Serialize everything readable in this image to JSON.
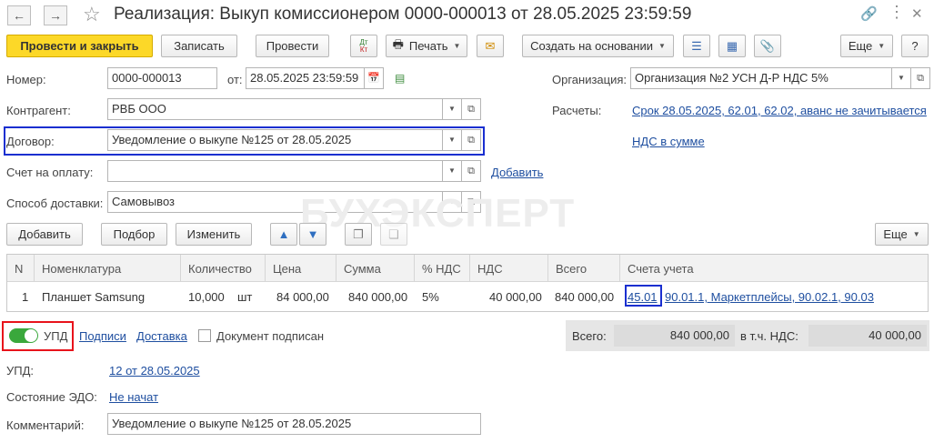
{
  "window": {
    "title": "Реализация: Выкуп комиссионером 0000-000013 от 28.05.2025 23:59:59"
  },
  "toolbar": {
    "post_close": "Провести и закрыть",
    "save": "Записать",
    "post": "Провести",
    "dt_kt_top": "Дт",
    "dt_kt_bottom": "Кт",
    "print": "Печать",
    "create_based": "Создать на основании",
    "more": "Еще",
    "help": "?"
  },
  "form": {
    "number_label": "Номер:",
    "number_value": "0000-000013",
    "from_label": "от:",
    "date_value": "28.05.2025 23:59:59",
    "org_label": "Организация:",
    "org_value": "Организация №2 УСН Д-Р НДС 5%",
    "counterparty_label": "Контрагент:",
    "counterparty_value": "РВБ ООО",
    "settlements_label": "Расчеты:",
    "settlements_link": "Срок 28.05.2025, 62.01, 62.02, аванс не зачитывается",
    "contract_label": "Договор:",
    "contract_value": "Уведомление о выкупе №125 от 28.05.2025",
    "vat_link": "НДС в сумме",
    "invoice_label": "Счет на оплату:",
    "invoice_value": "",
    "invoice_add_link": "Добавить",
    "delivery_label": "Способ доставки:",
    "delivery_value": "Самовывоз"
  },
  "watermark": "БУХЭКСПЕРТ",
  "table_toolbar": {
    "add": "Добавить",
    "pick": "Подбор",
    "edit": "Изменить",
    "more": "Еще"
  },
  "table": {
    "headers": [
      "N",
      "Номенклатура",
      "Количество",
      "Цена",
      "Сумма",
      "% НДС",
      "НДС",
      "Всего",
      "Счета учета"
    ],
    "rows": [
      {
        "n": "1",
        "item": "Планшет Samsung",
        "qty": "10,000",
        "unit": "шт",
        "price": "84 000,00",
        "sum": "840 000,00",
        "vat_rate": "5%",
        "vat": "40 000,00",
        "total": "840 000,00",
        "accounts_first": "45.01",
        "accounts_rest": "90.01.1, Маркетплейсы, 90.02.1, 90.03"
      }
    ]
  },
  "footer": {
    "upd_toggle_label": "УПД",
    "signatures_link": "Подписи",
    "delivery_link": "Доставка",
    "signed_label": "Документ подписан",
    "total_label": "Всего:",
    "total_value": "840 000,00",
    "vat_included_label": "в т.ч. НДС:",
    "vat_value": "40 000,00",
    "upd_label": "УПД:",
    "upd_link": "12 от 28.05.2025",
    "edo_label": "Состояние ЭДО:",
    "edo_link": "Не начат",
    "comment_label": "Комментарий:",
    "comment_value": "Уведомление о выкупе №125 от 28.05.2025"
  },
  "colors": {
    "primary_button": "#fcd828",
    "link": "#1f4fa0",
    "highlight_blue": "#1a2fd0",
    "highlight_red": "#e8131b",
    "toggle_on": "#3aa83c"
  }
}
